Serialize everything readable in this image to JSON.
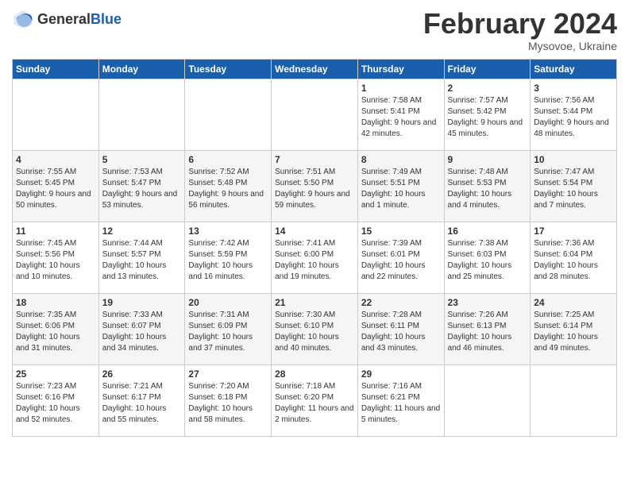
{
  "header": {
    "logo_general": "General",
    "logo_blue": "Blue",
    "month_title": "February 2024",
    "location": "Mysovoe, Ukraine"
  },
  "days_of_week": [
    "Sunday",
    "Monday",
    "Tuesday",
    "Wednesday",
    "Thursday",
    "Friday",
    "Saturday"
  ],
  "weeks": [
    [
      {
        "day": "",
        "content": ""
      },
      {
        "day": "",
        "content": ""
      },
      {
        "day": "",
        "content": ""
      },
      {
        "day": "",
        "content": ""
      },
      {
        "day": "1",
        "content": "Sunrise: 7:58 AM\nSunset: 5:41 PM\nDaylight: 9 hours\nand 42 minutes."
      },
      {
        "day": "2",
        "content": "Sunrise: 7:57 AM\nSunset: 5:42 PM\nDaylight: 9 hours\nand 45 minutes."
      },
      {
        "day": "3",
        "content": "Sunrise: 7:56 AM\nSunset: 5:44 PM\nDaylight: 9 hours\nand 48 minutes."
      }
    ],
    [
      {
        "day": "4",
        "content": "Sunrise: 7:55 AM\nSunset: 5:45 PM\nDaylight: 9 hours\nand 50 minutes."
      },
      {
        "day": "5",
        "content": "Sunrise: 7:53 AM\nSunset: 5:47 PM\nDaylight: 9 hours\nand 53 minutes."
      },
      {
        "day": "6",
        "content": "Sunrise: 7:52 AM\nSunset: 5:48 PM\nDaylight: 9 hours\nand 56 minutes."
      },
      {
        "day": "7",
        "content": "Sunrise: 7:51 AM\nSunset: 5:50 PM\nDaylight: 9 hours\nand 59 minutes."
      },
      {
        "day": "8",
        "content": "Sunrise: 7:49 AM\nSunset: 5:51 PM\nDaylight: 10 hours\nand 1 minute."
      },
      {
        "day": "9",
        "content": "Sunrise: 7:48 AM\nSunset: 5:53 PM\nDaylight: 10 hours\nand 4 minutes."
      },
      {
        "day": "10",
        "content": "Sunrise: 7:47 AM\nSunset: 5:54 PM\nDaylight: 10 hours\nand 7 minutes."
      }
    ],
    [
      {
        "day": "11",
        "content": "Sunrise: 7:45 AM\nSunset: 5:56 PM\nDaylight: 10 hours\nand 10 minutes."
      },
      {
        "day": "12",
        "content": "Sunrise: 7:44 AM\nSunset: 5:57 PM\nDaylight: 10 hours\nand 13 minutes."
      },
      {
        "day": "13",
        "content": "Sunrise: 7:42 AM\nSunset: 5:59 PM\nDaylight: 10 hours\nand 16 minutes."
      },
      {
        "day": "14",
        "content": "Sunrise: 7:41 AM\nSunset: 6:00 PM\nDaylight: 10 hours\nand 19 minutes."
      },
      {
        "day": "15",
        "content": "Sunrise: 7:39 AM\nSunset: 6:01 PM\nDaylight: 10 hours\nand 22 minutes."
      },
      {
        "day": "16",
        "content": "Sunrise: 7:38 AM\nSunset: 6:03 PM\nDaylight: 10 hours\nand 25 minutes."
      },
      {
        "day": "17",
        "content": "Sunrise: 7:36 AM\nSunset: 6:04 PM\nDaylight: 10 hours\nand 28 minutes."
      }
    ],
    [
      {
        "day": "18",
        "content": "Sunrise: 7:35 AM\nSunset: 6:06 PM\nDaylight: 10 hours\nand 31 minutes."
      },
      {
        "day": "19",
        "content": "Sunrise: 7:33 AM\nSunset: 6:07 PM\nDaylight: 10 hours\nand 34 minutes."
      },
      {
        "day": "20",
        "content": "Sunrise: 7:31 AM\nSunset: 6:09 PM\nDaylight: 10 hours\nand 37 minutes."
      },
      {
        "day": "21",
        "content": "Sunrise: 7:30 AM\nSunset: 6:10 PM\nDaylight: 10 hours\nand 40 minutes."
      },
      {
        "day": "22",
        "content": "Sunrise: 7:28 AM\nSunset: 6:11 PM\nDaylight: 10 hours\nand 43 minutes."
      },
      {
        "day": "23",
        "content": "Sunrise: 7:26 AM\nSunset: 6:13 PM\nDaylight: 10 hours\nand 46 minutes."
      },
      {
        "day": "24",
        "content": "Sunrise: 7:25 AM\nSunset: 6:14 PM\nDaylight: 10 hours\nand 49 minutes."
      }
    ],
    [
      {
        "day": "25",
        "content": "Sunrise: 7:23 AM\nSunset: 6:16 PM\nDaylight: 10 hours\nand 52 minutes."
      },
      {
        "day": "26",
        "content": "Sunrise: 7:21 AM\nSunset: 6:17 PM\nDaylight: 10 hours\nand 55 minutes."
      },
      {
        "day": "27",
        "content": "Sunrise: 7:20 AM\nSunset: 6:18 PM\nDaylight: 10 hours\nand 58 minutes."
      },
      {
        "day": "28",
        "content": "Sunrise: 7:18 AM\nSunset: 6:20 PM\nDaylight: 11 hours\nand 2 minutes."
      },
      {
        "day": "29",
        "content": "Sunrise: 7:16 AM\nSunset: 6:21 PM\nDaylight: 11 hours\nand 5 minutes."
      },
      {
        "day": "",
        "content": ""
      },
      {
        "day": "",
        "content": ""
      }
    ]
  ]
}
